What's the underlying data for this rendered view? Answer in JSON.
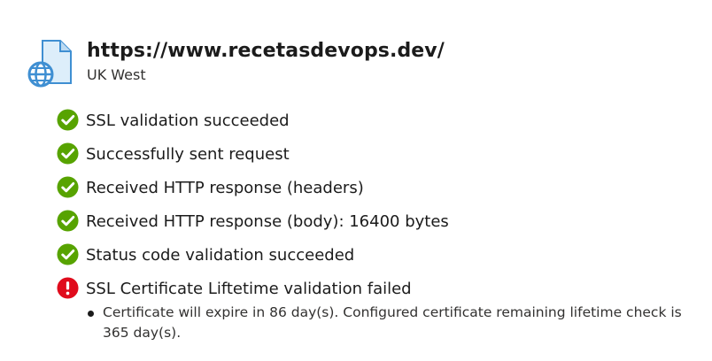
{
  "header": {
    "url": "https://www.recetasdevops.dev/",
    "region": "UK West",
    "icon": "web-page-globe-icon"
  },
  "colors": {
    "success": "#57a300",
    "error": "#e00b1c",
    "icon_blue": "#3f8fd2",
    "icon_page": "#ddeefa"
  },
  "checks": [
    {
      "label": "SSL validation succeeded",
      "status": "success",
      "icon": "check-circle-icon"
    },
    {
      "label": "Successfully sent request",
      "status": "success",
      "icon": "check-circle-icon"
    },
    {
      "label": "Received HTTP response (headers)",
      "status": "success",
      "icon": "check-circle-icon"
    },
    {
      "label": "Received HTTP response (body): 16400 bytes",
      "status": "success",
      "icon": "check-circle-icon"
    },
    {
      "label": "Status code validation succeeded",
      "status": "success",
      "icon": "check-circle-icon"
    },
    {
      "label": "SSL Certificate Liftetime validation failed",
      "status": "error",
      "icon": "error-circle-icon"
    }
  ],
  "failure_details": [
    "Certificate will expire in 86 day(s). Configured certificate remaining lifetime check is 365 day(s)."
  ]
}
